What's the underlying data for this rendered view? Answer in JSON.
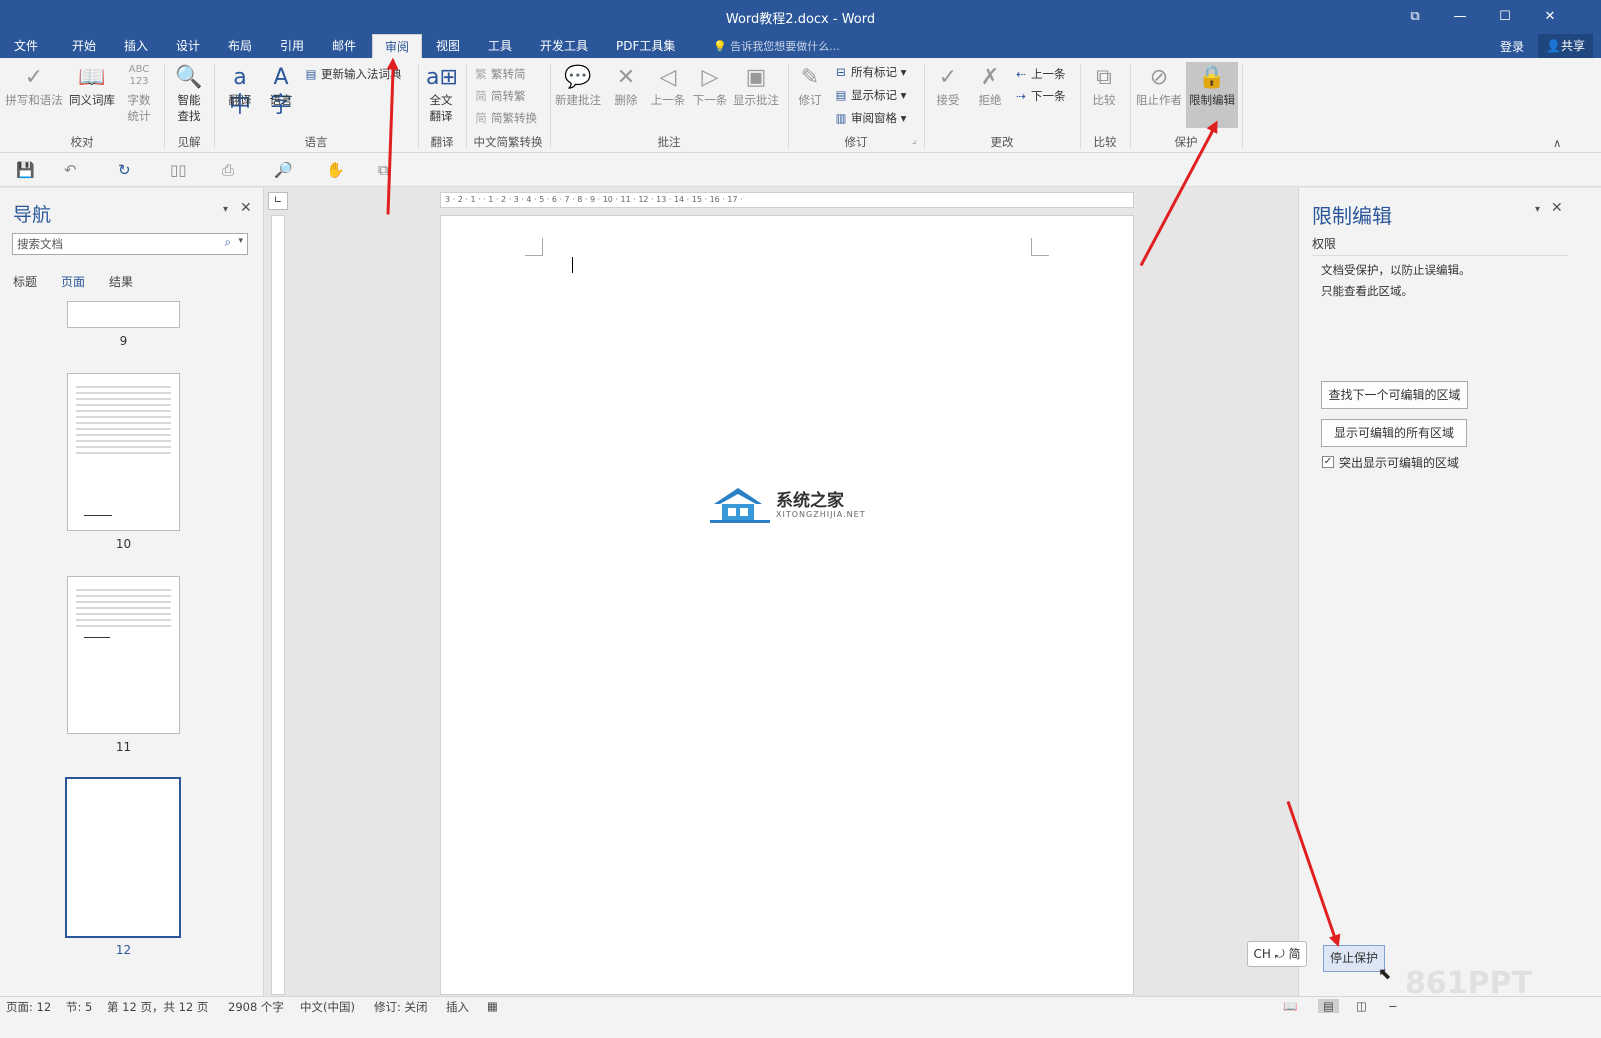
{
  "window": {
    "title": "Word教程2.docx - Word",
    "restore_icon": "⧉",
    "minimize_icon": "—",
    "maximize_icon": "☐",
    "close_icon": "✕"
  },
  "tabs": [
    "文件",
    "开始",
    "插入",
    "设计",
    "布局",
    "引用",
    "邮件",
    "审阅",
    "视图",
    "工具",
    "开发工具",
    "PDF工具集"
  ],
  "tell_me": "告诉我您想要做什么...",
  "login": "登录",
  "share": "共享",
  "ribbon": {
    "spelling": "拼写和语法",
    "thesaurus": "同义词库",
    "wordcount_line1": "字数",
    "wordcount_line2": "统计",
    "wordcount_icon_text": "ABC 123",
    "smart_line1": "智能",
    "smart_line2": "查找",
    "translate": "翻译",
    "language": "语言",
    "update_ime": "更新输入法词典",
    "full_translate_line1": "全文",
    "full_translate_line2": "翻译",
    "trad": "繁转简",
    "simp": "简转繁",
    "conv": "简繁转换",
    "new_comment": "新建批注",
    "delete": "删除",
    "prev": "上一条",
    "next": "下一条",
    "show_comments": "显示批注",
    "track": "修订",
    "all_markup": "所有标记",
    "show_markup": "显示标记",
    "review_pane": "审阅窗格",
    "accept": "接受",
    "reject": "拒绝",
    "prev2": "上一条",
    "next2": "下一条",
    "compare": "比较",
    "block_authors": "阻止作者",
    "restrict": "限制编辑",
    "groups": {
      "proofing": "校对",
      "insights": "见解",
      "language": "语言",
      "translate": "翻译",
      "chinese_conv": "中文简繁转换",
      "comments": "批注",
      "tracking": "修订",
      "changes": "更改",
      "compare": "比较",
      "protect": "保护"
    }
  },
  "nav": {
    "title": "导航",
    "search_placeholder": "搜索文档",
    "tabs": [
      "标题",
      "页面",
      "结果"
    ],
    "pages": [
      "9",
      "10",
      "11",
      "12"
    ]
  },
  "ruler": {
    "marks": "3 · 2 · 1 · · 1 · 2 · 3 · 4 · 5 · 6 · 7 · 8 · 9 · 10 · 11 · 12 · 13 · 14 · 15 · 16 · 17 ·"
  },
  "watermark": {
    "name": "系统之家",
    "url": "XITONGZHIJIA.NET"
  },
  "restrict_pane": {
    "title": "限制编辑",
    "section": "权限",
    "msg1": "文档受保护，以防止误编辑。",
    "msg2": "只能查看此区域。",
    "find_next": "查找下一个可编辑的区域",
    "show_all": "显示可编辑的所有区域",
    "highlight": "突出显示可编辑的区域",
    "highlight_checked": true,
    "stop": "停止保护"
  },
  "ime": "CH ⤾ 简",
  "status": {
    "page": "页面: 12",
    "section": "节: 5",
    "pages": "第 12 页，共 12 页",
    "words": "2908 个字",
    "lang": "中文(中国)",
    "track": "修订: 关闭",
    "insert": "插入"
  },
  "corner_watermark": "861PPT",
  "colors": {
    "accent": "#2b579a",
    "arrow": "#e02020"
  }
}
